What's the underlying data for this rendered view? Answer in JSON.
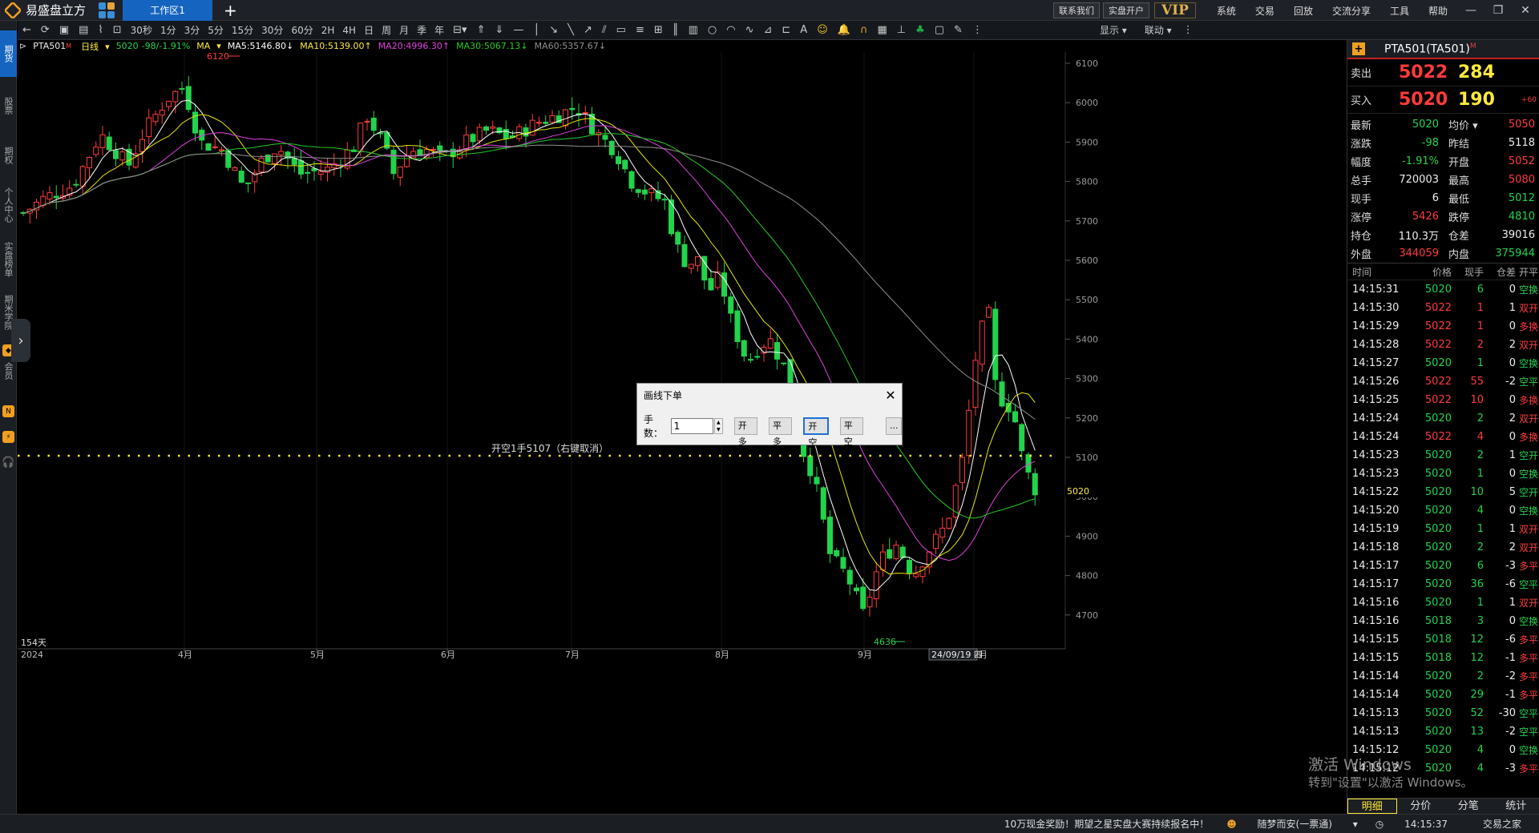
{
  "app": {
    "name": "易盛盘立方",
    "workspace_tab": "工作区1",
    "top_buttons": [
      "联系我们",
      "实盘开户"
    ],
    "vip": "VIP",
    "menus": [
      "系统",
      "交易",
      "回放",
      "交流分享",
      "工具",
      "帮助"
    ]
  },
  "sidebar": [
    "期货",
    "股票",
    "期权",
    "个人中心",
    "实盘榜单",
    "期米学院",
    "会员"
  ],
  "toolbar": {
    "periods": [
      "30秒",
      "1分",
      "3分",
      "5分",
      "15分",
      "30分",
      "60分",
      "2H",
      "4H",
      "日",
      "周",
      "月",
      "季",
      "年"
    ],
    "right": [
      "显示",
      "联动"
    ]
  },
  "ma_bar": {
    "symbol": "PTA501",
    "badge": "M",
    "period": "日线",
    "price": "5020",
    "change": "-98/-1.91%",
    "ma_label": "MA",
    "ma5": "MA5:5146.80↓",
    "ma10": "MA10:5139.00↑",
    "ma20": "MA20:4996.30↑",
    "ma30": "MA30:5067.13↓",
    "ma60": "MA60:5357.67↓"
  },
  "chart_labels": {
    "high_mark": "6120",
    "low_mark": "4636",
    "last_price": "5020",
    "bar_count": "154天",
    "order_line_text": "开空1手5107（右键取消）",
    "crosshair_date": "24/09/19 四",
    "x_labels": [
      "2024",
      "4月",
      "5月",
      "6月",
      "7月",
      "8月",
      "9月",
      "10月"
    ],
    "y_labels": [
      "6100",
      "6000",
      "5900",
      "5800",
      "5700",
      "5600",
      "5500",
      "5400",
      "5300",
      "5200",
      "5100",
      "5000",
      "4900",
      "4800",
      "4700"
    ]
  },
  "chart_data": {
    "type": "candlestick",
    "y_range": [
      4636,
      6120
    ],
    "order_price": 5107,
    "last": 5020,
    "ma_colors": {
      "ma5": "#ffffff",
      "ma10": "#e6e600",
      "ma20": "#e040e0",
      "ma30": "#22cc22",
      "ma60": "#909090"
    }
  },
  "dialog": {
    "title": "画线下单",
    "qty_label": "手数：",
    "qty_value": "1",
    "buttons": [
      "开多",
      "平多",
      "开空",
      "平空"
    ],
    "more": "..."
  },
  "quote": {
    "header": "PTA501(TA501)",
    "header_badge": "M",
    "sell_label": "卖出",
    "sell_price": "5022",
    "sell_vol": "284",
    "buy_label": "买入",
    "buy_price": "5020",
    "buy_vol": "190",
    "buy_chg": "+60",
    "rows": [
      [
        "最新",
        "5020",
        "均价 ▾",
        "5050"
      ],
      [
        "涨跌",
        "-98",
        "昨结",
        "5118"
      ],
      [
        "幅度",
        "-1.91%",
        "开盘",
        "5052"
      ],
      [
        "总手",
        "720003",
        "最高",
        "5080"
      ],
      [
        "现手",
        "6",
        "最低",
        "5012"
      ],
      [
        "涨停",
        "5426",
        "跌停",
        "4810"
      ],
      [
        "持仓",
        "110.3万",
        "仓差",
        "39016"
      ],
      [
        "外盘",
        "344059",
        "内盘",
        "375944"
      ]
    ]
  },
  "ticks": {
    "headers": [
      "时间",
      "价格",
      "现手",
      "仓差",
      "开平"
    ],
    "rows": [
      [
        "14:15:31",
        "5020",
        "6",
        "0",
        "空换"
      ],
      [
        "14:15:30",
        "5022",
        "1",
        "1",
        "双开"
      ],
      [
        "14:15:29",
        "5022",
        "1",
        "0",
        "多换"
      ],
      [
        "14:15:28",
        "5022",
        "2",
        "2",
        "双开"
      ],
      [
        "14:15:27",
        "5020",
        "1",
        "0",
        "空换"
      ],
      [
        "14:15:26",
        "5022",
        "55",
        "-2",
        "空平"
      ],
      [
        "14:15:25",
        "5022",
        "10",
        "0",
        "多换"
      ],
      [
        "14:15:24",
        "5020",
        "2",
        "2",
        "双开"
      ],
      [
        "14:15:24",
        "5022",
        "4",
        "0",
        "多换"
      ],
      [
        "14:15:23",
        "5020",
        "2",
        "1",
        "空开"
      ],
      [
        "14:15:23",
        "5020",
        "1",
        "0",
        "空换"
      ],
      [
        "14:15:22",
        "5020",
        "10",
        "5",
        "空开"
      ],
      [
        "14:15:20",
        "5020",
        "4",
        "0",
        "空换"
      ],
      [
        "14:15:19",
        "5020",
        "1",
        "1",
        "双开"
      ],
      [
        "14:15:18",
        "5020",
        "2",
        "2",
        "双开"
      ],
      [
        "14:15:17",
        "5020",
        "6",
        "-3",
        "多平"
      ],
      [
        "14:15:17",
        "5020",
        "36",
        "-6",
        "空平"
      ],
      [
        "14:15:16",
        "5020",
        "1",
        "1",
        "双开"
      ],
      [
        "14:15:16",
        "5018",
        "3",
        "0",
        "空换"
      ],
      [
        "14:15:15",
        "5018",
        "12",
        "-6",
        "多平"
      ],
      [
        "14:15:15",
        "5018",
        "12",
        "-1",
        "多平"
      ],
      [
        "14:15:14",
        "5020",
        "2",
        "-2",
        "多平"
      ],
      [
        "14:15:14",
        "5020",
        "29",
        "-1",
        "多平"
      ],
      [
        "14:15:13",
        "5020",
        "52",
        "-30",
        "空平"
      ],
      [
        "14:15:13",
        "5020",
        "13",
        "-2",
        "空平"
      ],
      [
        "14:15:12",
        "5020",
        "4",
        "0",
        "空换"
      ],
      [
        "14:15:12",
        "5020",
        "4",
        "-3",
        "多平"
      ]
    ],
    "tabs": [
      "明细",
      "分价",
      "分笔",
      "统计"
    ]
  },
  "watermark": {
    "line1": "激活 Windows",
    "line2": "转到\"设置\"以激活 Windows。"
  },
  "status": {
    "news": "10万现金奖励！期望之星实盘大赛持续报名中！",
    "user": "随梦而安(一票通)",
    "time": "14:15:37",
    "brand": "交易之家"
  }
}
